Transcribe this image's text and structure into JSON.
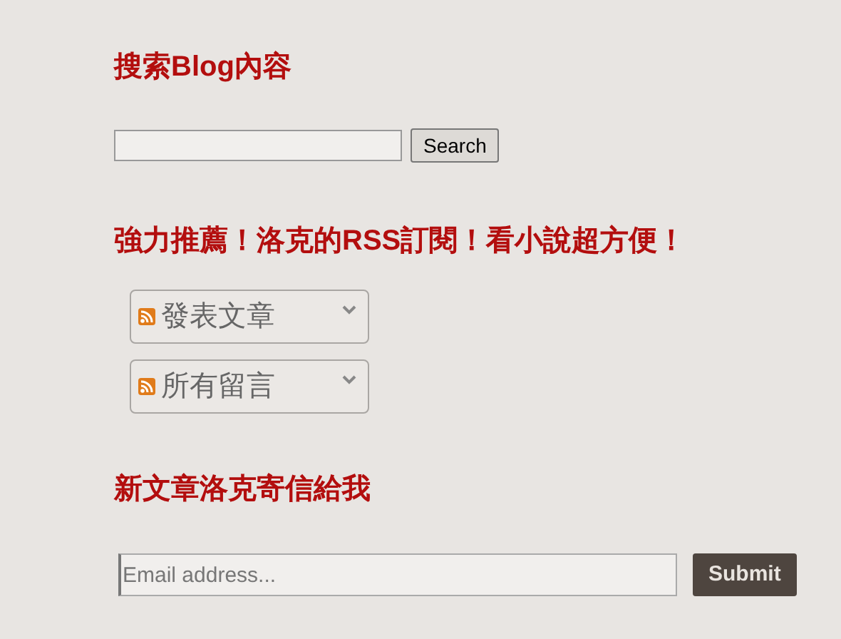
{
  "search_widget": {
    "title": "搜索Blog內容",
    "button": "Search"
  },
  "rss_widget": {
    "title": "強力推薦！洛克的RSS訂閱！看小說超方便！",
    "feeds": [
      {
        "label": "發表文章",
        "expanded": false
      },
      {
        "label": "所有留言",
        "expanded": false
      }
    ]
  },
  "email_widget": {
    "title": "新文章洛克寄信給我",
    "placeholder": "Email address...",
    "button": "Submit"
  }
}
